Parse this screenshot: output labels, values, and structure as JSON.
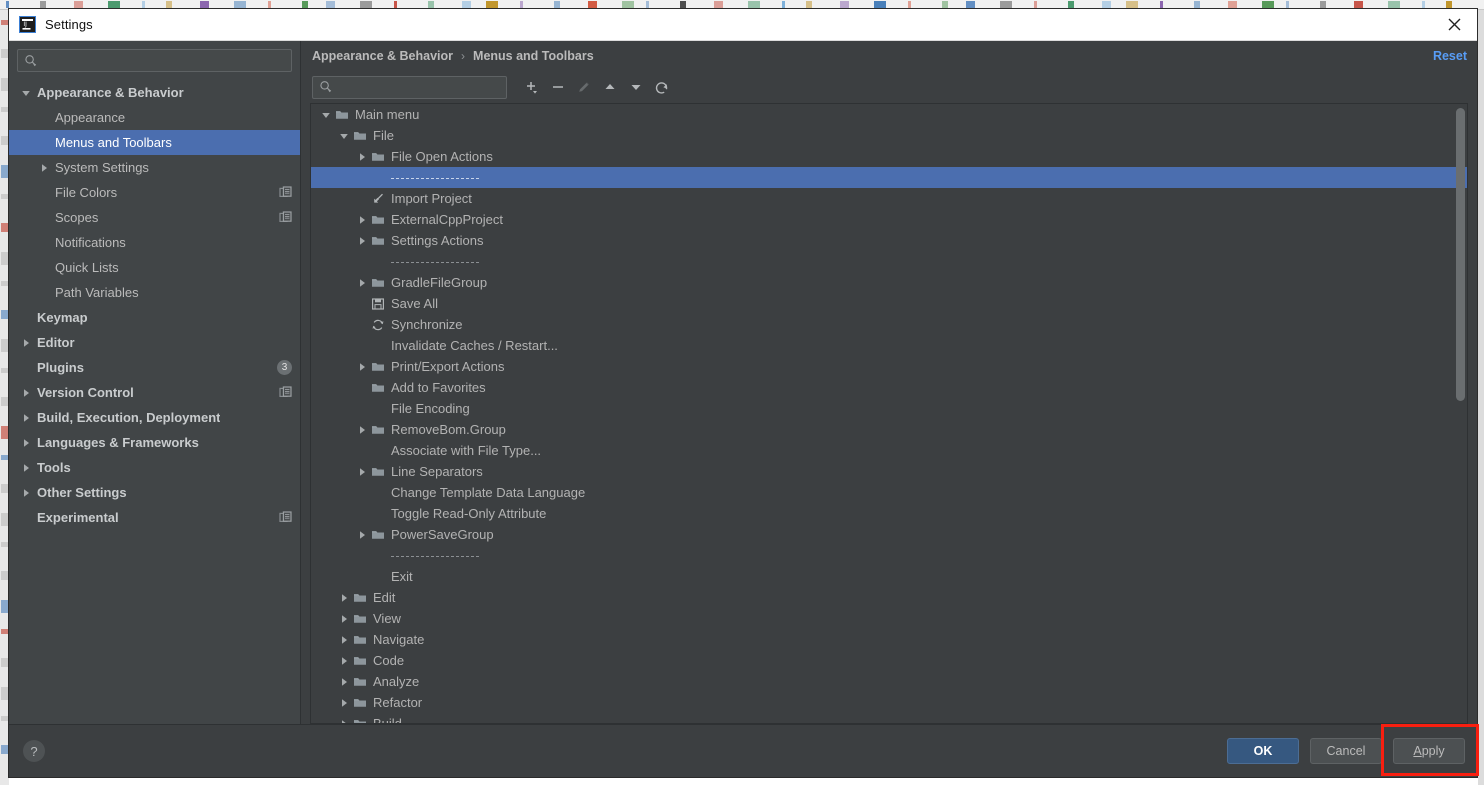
{
  "window": {
    "title": "Settings",
    "app_icon": "intellij-idea-icon",
    "close_icon": "close-icon"
  },
  "sidebar": {
    "search": {
      "value": "",
      "placeholder": "",
      "icon": "search-icon"
    },
    "items": [
      {
        "label": "Appearance & Behavior",
        "indent": 0,
        "arrow": "down",
        "bold": true,
        "selected": false,
        "tail": ""
      },
      {
        "label": "Appearance",
        "indent": 1,
        "arrow": "none",
        "bold": false,
        "selected": false,
        "tail": ""
      },
      {
        "label": "Menus and Toolbars",
        "indent": 1,
        "arrow": "none",
        "bold": false,
        "selected": true,
        "tail": ""
      },
      {
        "label": "System Settings",
        "indent": 1,
        "arrow": "right",
        "bold": false,
        "selected": false,
        "tail": ""
      },
      {
        "label": "File Colors",
        "indent": 1,
        "arrow": "none",
        "bold": false,
        "selected": false,
        "tail": "copy-icon"
      },
      {
        "label": "Scopes",
        "indent": 1,
        "arrow": "none",
        "bold": false,
        "selected": false,
        "tail": "copy-icon"
      },
      {
        "label": "Notifications",
        "indent": 1,
        "arrow": "none",
        "bold": false,
        "selected": false,
        "tail": ""
      },
      {
        "label": "Quick Lists",
        "indent": 1,
        "arrow": "none",
        "bold": false,
        "selected": false,
        "tail": ""
      },
      {
        "label": "Path Variables",
        "indent": 1,
        "arrow": "none",
        "bold": false,
        "selected": false,
        "tail": ""
      },
      {
        "label": "Keymap",
        "indent": 0,
        "arrow": "none",
        "bold": true,
        "selected": false,
        "tail": ""
      },
      {
        "label": "Editor",
        "indent": 0,
        "arrow": "right",
        "bold": true,
        "selected": false,
        "tail": ""
      },
      {
        "label": "Plugins",
        "indent": 0,
        "arrow": "none",
        "bold": true,
        "selected": false,
        "tail": "badge",
        "badge": "3"
      },
      {
        "label": "Version Control",
        "indent": 0,
        "arrow": "right",
        "bold": true,
        "selected": false,
        "tail": "copy-icon"
      },
      {
        "label": "Build, Execution, Deployment",
        "indent": 0,
        "arrow": "right",
        "bold": true,
        "selected": false,
        "tail": ""
      },
      {
        "label": "Languages & Frameworks",
        "indent": 0,
        "arrow": "right",
        "bold": true,
        "selected": false,
        "tail": ""
      },
      {
        "label": "Tools",
        "indent": 0,
        "arrow": "right",
        "bold": true,
        "selected": false,
        "tail": ""
      },
      {
        "label": "Other Settings",
        "indent": 0,
        "arrow": "right",
        "bold": true,
        "selected": false,
        "tail": ""
      },
      {
        "label": "Experimental",
        "indent": 0,
        "arrow": "none",
        "bold": true,
        "selected": false,
        "tail": "copy-icon"
      }
    ]
  },
  "main": {
    "breadcrumb": {
      "first": "Appearance & Behavior",
      "separator": "›",
      "current": "Menus and Toolbars"
    },
    "reset_label": "Reset",
    "toolbar": {
      "search": {
        "value": "",
        "placeholder": "",
        "icon": "search-icon"
      },
      "buttons": [
        {
          "name": "add-button",
          "icon": "plus-dropdown-icon",
          "disabled": false
        },
        {
          "name": "remove-button",
          "icon": "minus-icon",
          "disabled": false
        },
        {
          "name": "edit-button",
          "icon": "pencil-icon",
          "disabled": true
        },
        {
          "name": "move-up-button",
          "icon": "arrow-up-icon",
          "disabled": false
        },
        {
          "name": "move-down-button",
          "icon": "arrow-down-icon",
          "disabled": false
        },
        {
          "name": "restore-button",
          "icon": "revert-icon",
          "disabled": false
        }
      ]
    },
    "tree": [
      {
        "label": "Main menu",
        "indent": 0,
        "arrow": "down",
        "icon": "folder-icon",
        "selected": false,
        "separator": false
      },
      {
        "label": "File",
        "indent": 1,
        "arrow": "down",
        "icon": "folder-icon",
        "selected": false,
        "separator": false
      },
      {
        "label": "File Open Actions",
        "indent": 2,
        "arrow": "right",
        "icon": "folder-icon",
        "selected": false,
        "separator": false
      },
      {
        "label": "",
        "indent": 2,
        "arrow": "none",
        "icon": "none",
        "selected": true,
        "separator": true
      },
      {
        "label": "Import Project",
        "indent": 2,
        "arrow": "none",
        "icon": "import-icon",
        "selected": false,
        "separator": false
      },
      {
        "label": "ExternalCppProject",
        "indent": 2,
        "arrow": "right",
        "icon": "folder-icon",
        "selected": false,
        "separator": false
      },
      {
        "label": "Settings Actions",
        "indent": 2,
        "arrow": "right",
        "icon": "folder-icon",
        "selected": false,
        "separator": false
      },
      {
        "label": "",
        "indent": 2,
        "arrow": "none",
        "icon": "none",
        "selected": false,
        "separator": true
      },
      {
        "label": "GradleFileGroup",
        "indent": 2,
        "arrow": "right",
        "icon": "folder-icon",
        "selected": false,
        "separator": false
      },
      {
        "label": "Save All",
        "indent": 2,
        "arrow": "none",
        "icon": "save-icon",
        "selected": false,
        "separator": false
      },
      {
        "label": "Synchronize",
        "indent": 2,
        "arrow": "none",
        "icon": "sync-icon",
        "selected": false,
        "separator": false
      },
      {
        "label": "Invalidate Caches / Restart...",
        "indent": 2,
        "arrow": "none",
        "icon": "none",
        "selected": false,
        "separator": false
      },
      {
        "label": "Print/Export Actions",
        "indent": 2,
        "arrow": "right",
        "icon": "folder-icon",
        "selected": false,
        "separator": false
      },
      {
        "label": "Add to Favorites",
        "indent": 2,
        "arrow": "none",
        "icon": "folder-icon",
        "selected": false,
        "separator": false
      },
      {
        "label": "File Encoding",
        "indent": 2,
        "arrow": "none",
        "icon": "none",
        "selected": false,
        "separator": false
      },
      {
        "label": "RemoveBom.Group",
        "indent": 2,
        "arrow": "right",
        "icon": "folder-icon",
        "selected": false,
        "separator": false
      },
      {
        "label": "Associate with File Type...",
        "indent": 2,
        "arrow": "none",
        "icon": "none",
        "selected": false,
        "separator": false
      },
      {
        "label": "Line Separators",
        "indent": 2,
        "arrow": "right",
        "icon": "folder-icon",
        "selected": false,
        "separator": false
      },
      {
        "label": "Change Template Data Language",
        "indent": 2,
        "arrow": "none",
        "icon": "none",
        "selected": false,
        "separator": false
      },
      {
        "label": "Toggle Read-Only Attribute",
        "indent": 2,
        "arrow": "none",
        "icon": "none",
        "selected": false,
        "separator": false
      },
      {
        "label": "PowerSaveGroup",
        "indent": 2,
        "arrow": "right",
        "icon": "folder-icon",
        "selected": false,
        "separator": false
      },
      {
        "label": "",
        "indent": 2,
        "arrow": "none",
        "icon": "none",
        "selected": false,
        "separator": true
      },
      {
        "label": "Exit",
        "indent": 2,
        "arrow": "none",
        "icon": "none",
        "selected": false,
        "separator": false
      },
      {
        "label": "Edit",
        "indent": 1,
        "arrow": "right",
        "icon": "folder-icon",
        "selected": false,
        "separator": false
      },
      {
        "label": "View",
        "indent": 1,
        "arrow": "right",
        "icon": "folder-icon",
        "selected": false,
        "separator": false
      },
      {
        "label": "Navigate",
        "indent": 1,
        "arrow": "right",
        "icon": "folder-icon",
        "selected": false,
        "separator": false
      },
      {
        "label": "Code",
        "indent": 1,
        "arrow": "right",
        "icon": "folder-icon",
        "selected": false,
        "separator": false
      },
      {
        "label": "Analyze",
        "indent": 1,
        "arrow": "right",
        "icon": "folder-icon",
        "selected": false,
        "separator": false
      },
      {
        "label": "Refactor",
        "indent": 1,
        "arrow": "right",
        "icon": "folder-icon",
        "selected": false,
        "separator": false
      },
      {
        "label": "Build",
        "indent": 1,
        "arrow": "right",
        "icon": "folder-icon",
        "selected": false,
        "separator": false
      }
    ]
  },
  "footer": {
    "help_label": "?",
    "ok_label": "OK",
    "cancel_label": "Cancel",
    "apply_label": "Apply",
    "apply_mnemonic": "A",
    "apply_rest": "pply",
    "annotation_color": "#f81f10"
  },
  "colors": {
    "background": "#3c3f41",
    "sidebar": "#414547",
    "selection": "#4b6eaf",
    "link": "#589df6",
    "primary_button": "#365880",
    "text": "#b3b3b3"
  }
}
